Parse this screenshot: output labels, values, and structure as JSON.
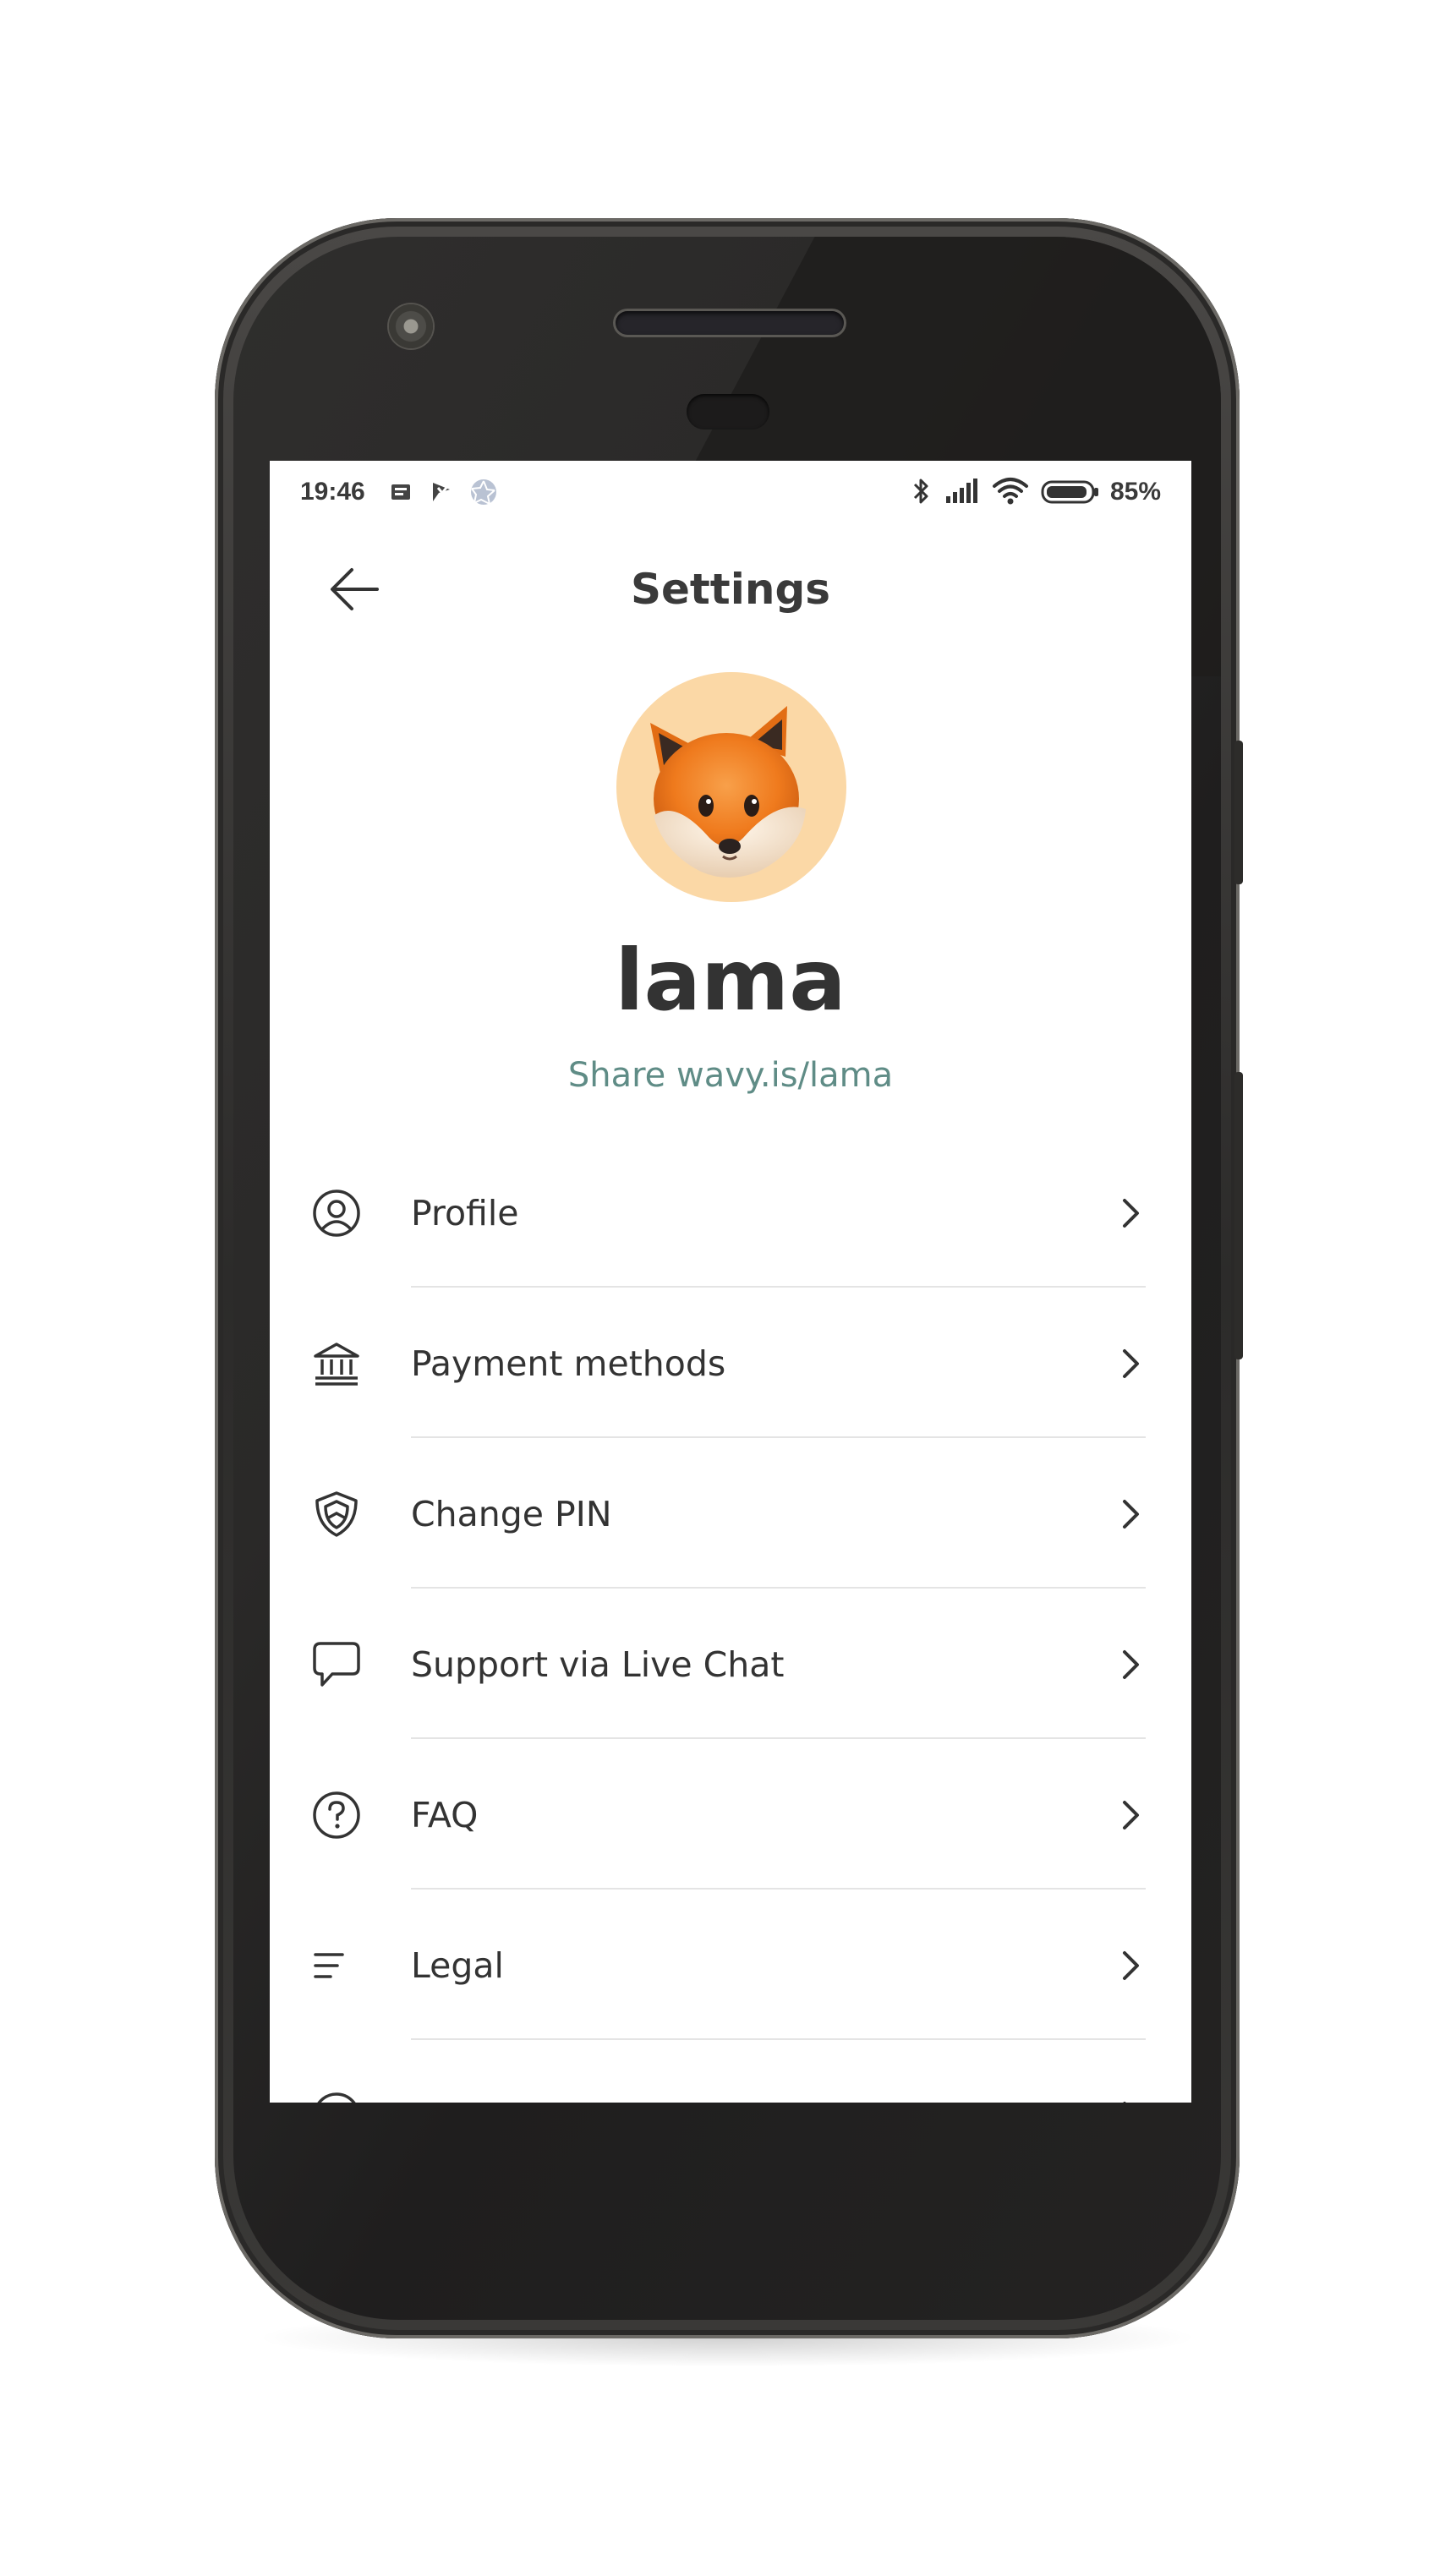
{
  "status_bar": {
    "time": "19:46",
    "battery_percent": "85%",
    "left_icons": [
      "notification-icon",
      "flag-icon",
      "aperture-icon"
    ],
    "right_icons": [
      "bluetooth-icon",
      "signal-icon",
      "wifi-icon",
      "battery-icon"
    ]
  },
  "header": {
    "title": "Settings",
    "back_icon": "arrow-left-icon"
  },
  "profile": {
    "avatar_icon": "fox-avatar",
    "username": "lama",
    "share_link": "Share wavy.is/lama",
    "avatar_bg": "#fbd8a6"
  },
  "menu": {
    "items": [
      {
        "label": "Profile",
        "icon": "user-circle-icon"
      },
      {
        "label": "Payment methods",
        "icon": "bank-icon"
      },
      {
        "label": "Change PIN",
        "icon": "shield-icon"
      },
      {
        "label": "Support via Live Chat",
        "icon": "chat-bubble-icon"
      },
      {
        "label": "FAQ",
        "icon": "question-circle-icon"
      },
      {
        "label": "Legal",
        "icon": "text-lines-icon"
      }
    ]
  },
  "colors": {
    "accent": "#5f8c86",
    "text": "#333333",
    "divider": "#e4e4e4",
    "phone_body": "#2c2b2a"
  }
}
